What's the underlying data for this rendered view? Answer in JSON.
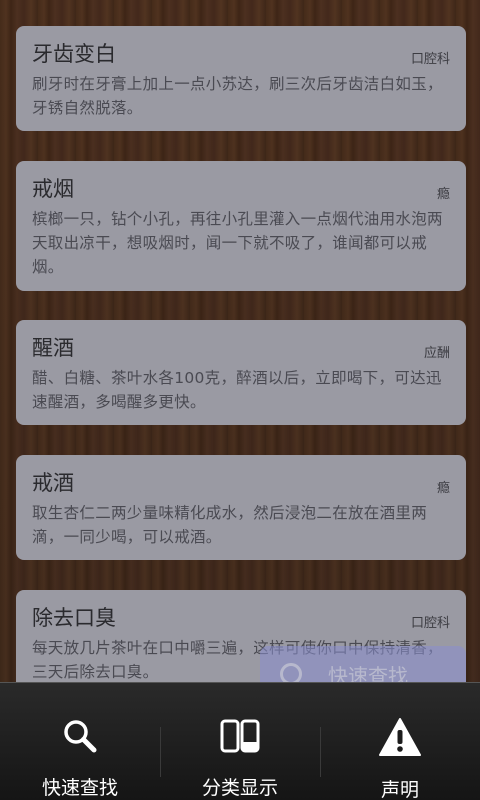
{
  "cards": [
    {
      "title": "牙齿变白",
      "category": "口腔科",
      "body": "刷牙时在牙膏上加上一点小苏达，刷三次后牙齿洁白如玉，牙锈自然脱落。"
    },
    {
      "title": "戒烟",
      "category": "瘾",
      "body": "槟榔一只，钻个小孔，再往小孔里灌入一点烟代油用水泡两天取出凉干，想吸烟时，闻一下就不吸了，谁闻都可以戒烟。"
    },
    {
      "title": "醒酒",
      "category": "应酬",
      "body": "醋、白糖、茶叶水各100克，醉酒以后，立即喝下，可达迅速醒酒，多喝醒多更快。"
    },
    {
      "title": "戒酒",
      "category": "瘾",
      "body": "取生杏仁二两少量味精化成水，然后浸泡二在放在酒里两滴，一同少喝，可以戒酒。"
    },
    {
      "title": "除去口臭",
      "category": "口腔科",
      "body": "每天放几片茶叶在口中嚼三遍，这样可使你口中保持清香，三天后除去口臭。"
    }
  ],
  "floating_search": {
    "label": "快速查找",
    "icon": "search-icon"
  },
  "menu": {
    "items": [
      {
        "label": "快速查找",
        "icon": "search-icon"
      },
      {
        "label": "分类显示",
        "icon": "panels-icon"
      },
      {
        "label": "声明",
        "icon": "warning-icon"
      }
    ]
  },
  "colors": {
    "card": "#9a9aa3",
    "menu_bg": "#1c1c1c",
    "accent": "#8a8fd0"
  }
}
